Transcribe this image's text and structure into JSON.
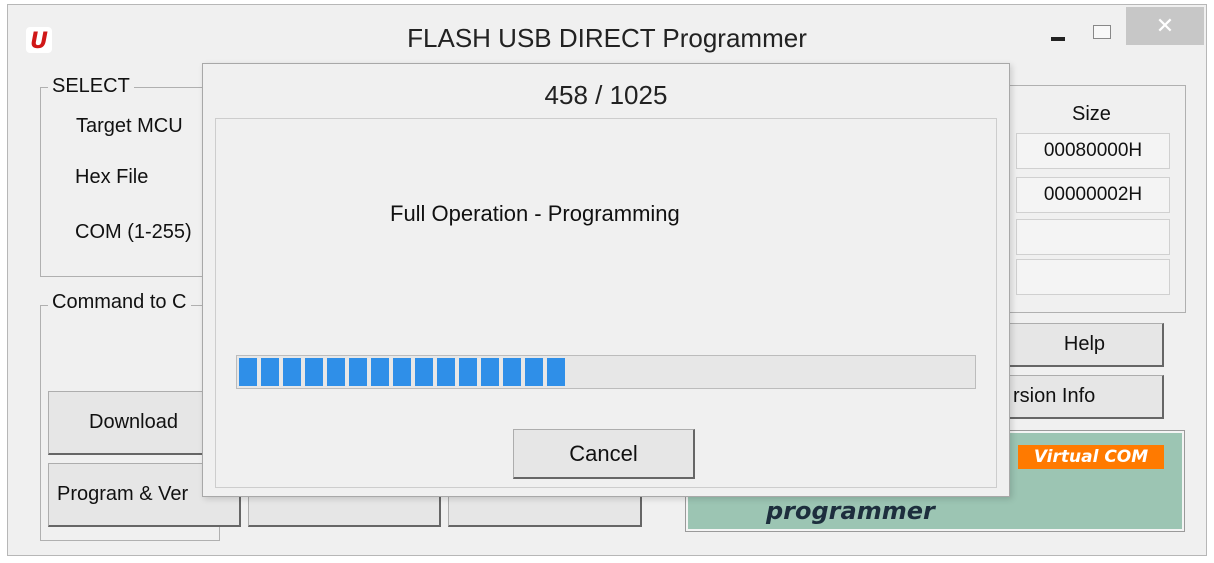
{
  "window": {
    "title": "FLASH USB DIRECT Programmer",
    "icon": "U",
    "close_glyph": "✕"
  },
  "select_group": {
    "label": "SELECT",
    "target_mcu_label": "Target MCU",
    "hex_file_label": "Hex File",
    "com_label": "COM (1-255)"
  },
  "command_group": {
    "label": "Command to C"
  },
  "buttons": {
    "download": "Download",
    "program_verify": "Program & Ver",
    "help": "Help",
    "version_info": "rsion Info"
  },
  "size_table": {
    "header": "Size",
    "rows": [
      "00080000H",
      "00000002H",
      "",
      ""
    ]
  },
  "banner": {
    "tag": "Virtual COM",
    "text": "programmer"
  },
  "progress_dialog": {
    "counter": "458 / 1025",
    "status": "Full Operation - Programming",
    "progress_fraction": 0.447,
    "cancel_label": "Cancel"
  },
  "colors": {
    "progress": "#2f8fe8",
    "banner_bg": "#9cc5b3",
    "banner_tag": "#ff7a00",
    "app_icon": "#d01818"
  }
}
